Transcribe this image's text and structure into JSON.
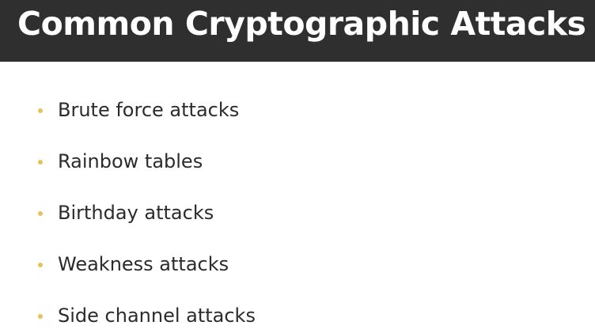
{
  "slide": {
    "title": "Common Cryptographic Attacks",
    "bullets": [
      "Brute force attacks",
      "Rainbow tables",
      "Birthday attacks",
      "Weakness attacks",
      "Side channel attacks"
    ]
  },
  "colors": {
    "title_bar": "#2f2f2f",
    "title_text": "#ffffff",
    "bullet": "#e8c15a",
    "body_text": "#2b2b2b",
    "background": "#ffffff"
  }
}
